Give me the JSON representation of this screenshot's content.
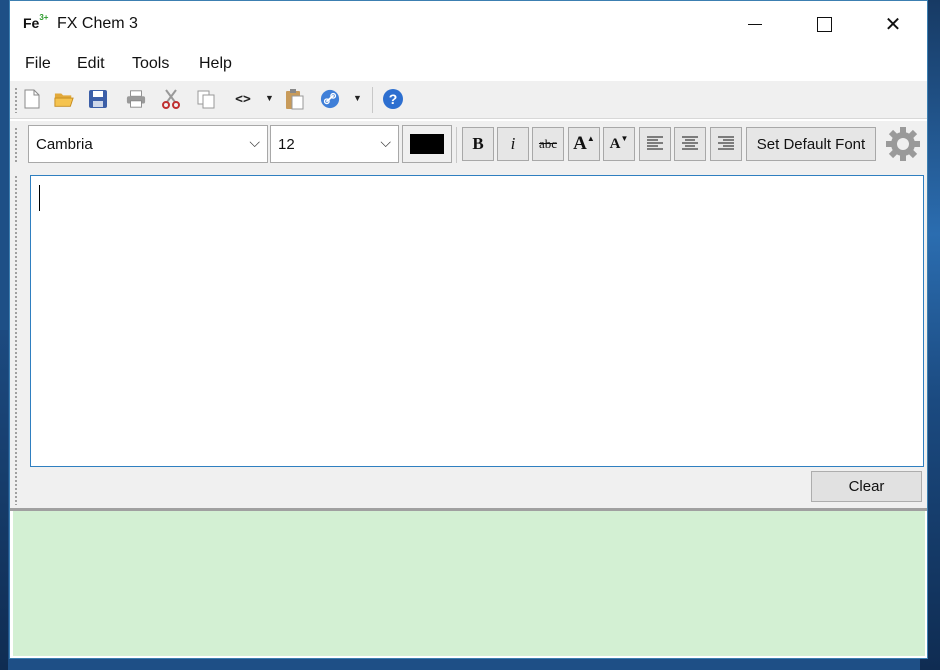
{
  "window": {
    "title": "FX Chem 3",
    "app_icon_text": "Fe",
    "app_icon_sup": "3+"
  },
  "titlebar": {
    "min_icon": "minimize-icon",
    "max_icon": "maximize-icon",
    "close_icon": "close-icon",
    "close_glyph": "✕"
  },
  "menu": [
    "File",
    "Edit",
    "Tools",
    "Help"
  ],
  "toolbar": {
    "icons": [
      "new-document-icon",
      "open-folder-icon",
      "save-icon",
      "print-icon",
      "cut-icon",
      "copy-icon",
      "code-icon",
      "paste-icon",
      "link-icon",
      "help-icon"
    ],
    "code_glyph": "<>",
    "help_glyph": "?",
    "dropdown_arrow": "▼"
  },
  "format": {
    "font_name": "Cambria",
    "font_size": "12",
    "combo_arrow": "⌵",
    "text_color": "#000000",
    "bold": "B",
    "italic": "i",
    "strike": "abc",
    "grow": "A",
    "shrink": "A",
    "set_default": "Set Default Font"
  },
  "editor": {
    "content": ""
  },
  "actions": {
    "clear": "Clear"
  },
  "colors": {
    "accent": "#2f7fc0",
    "output_bg": "#d3f0d3",
    "toolbar_bg": "#f0f0f0"
  }
}
